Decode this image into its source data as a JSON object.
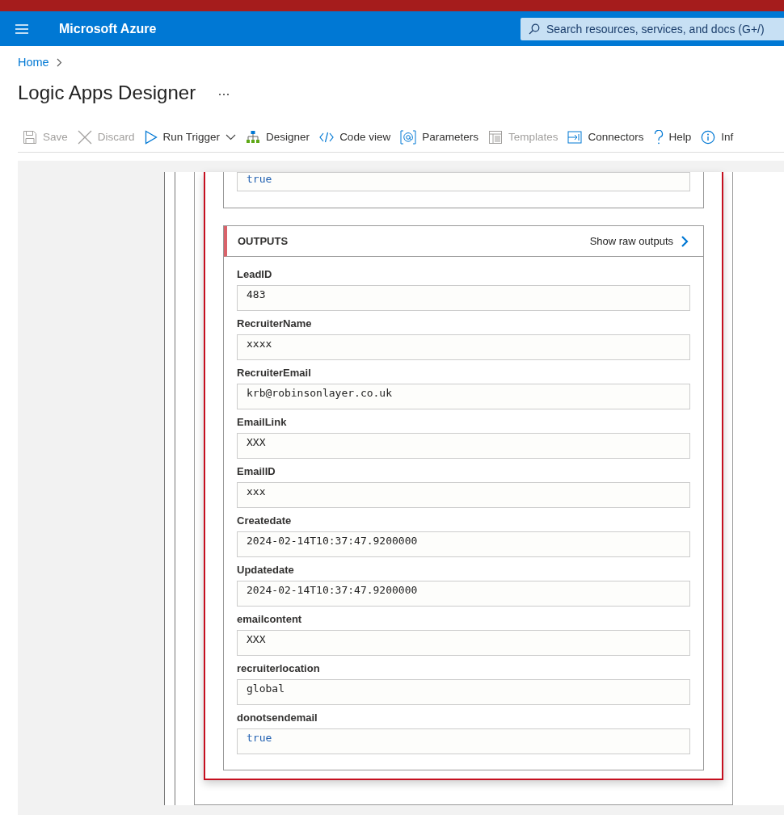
{
  "header": {
    "brand": "Microsoft Azure",
    "search": {
      "placeholder": "Search resources, services, and docs (G+/)"
    }
  },
  "breadcrumb": [
    "Home"
  ],
  "title": "Logic Apps Designer",
  "toolbar": [
    {
      "kind": "save",
      "label": "Save",
      "disabled": true
    },
    {
      "kind": "discard",
      "label": "Discard",
      "disabled": true
    },
    {
      "kind": "run",
      "label": "Run Trigger",
      "disabled": false
    },
    {
      "kind": "designer",
      "label": "Designer",
      "disabled": false
    },
    {
      "kind": "code",
      "label": "Code view",
      "disabled": false
    },
    {
      "kind": "parameters",
      "label": "Parameters",
      "disabled": false
    },
    {
      "kind": "templates",
      "label": "Templates",
      "disabled": true
    },
    {
      "kind": "connectors",
      "label": "Connectors",
      "disabled": false
    },
    {
      "kind": "help",
      "label": "Help",
      "disabled": false
    },
    {
      "kind": "info",
      "label": "Inf",
      "disabled": false
    }
  ],
  "previous_field": {
    "value": "true",
    "kind": "boolean"
  },
  "outputs": {
    "title": "OUTPUTS",
    "raw_link": "Show raw outputs",
    "fields": [
      {
        "label": "LeadID",
        "value": "483",
        "kind": "string"
      },
      {
        "label": "RecruiterName",
        "value": "xxxx",
        "kind": "string"
      },
      {
        "label": "RecruiterEmail",
        "value": "krb@robinsonlayer.co.uk",
        "kind": "string"
      },
      {
        "label": "EmailLink",
        "value": "XXX",
        "kind": "string"
      },
      {
        "label": "EmailID",
        "value": "xxx",
        "kind": "string"
      },
      {
        "label": "Createdate",
        "value": "2024-02-14T10:37:47.9200000",
        "kind": "string"
      },
      {
        "label": "Updatedate",
        "value": "2024-02-14T10:37:47.9200000",
        "kind": "string"
      },
      {
        "label": "emailcontent",
        "value": "XXX",
        "kind": "string"
      },
      {
        "label": "recruiterlocation",
        "value": "global",
        "kind": "string"
      },
      {
        "label": "donotsendemail",
        "value": "true",
        "kind": "boolean"
      }
    ]
  }
}
